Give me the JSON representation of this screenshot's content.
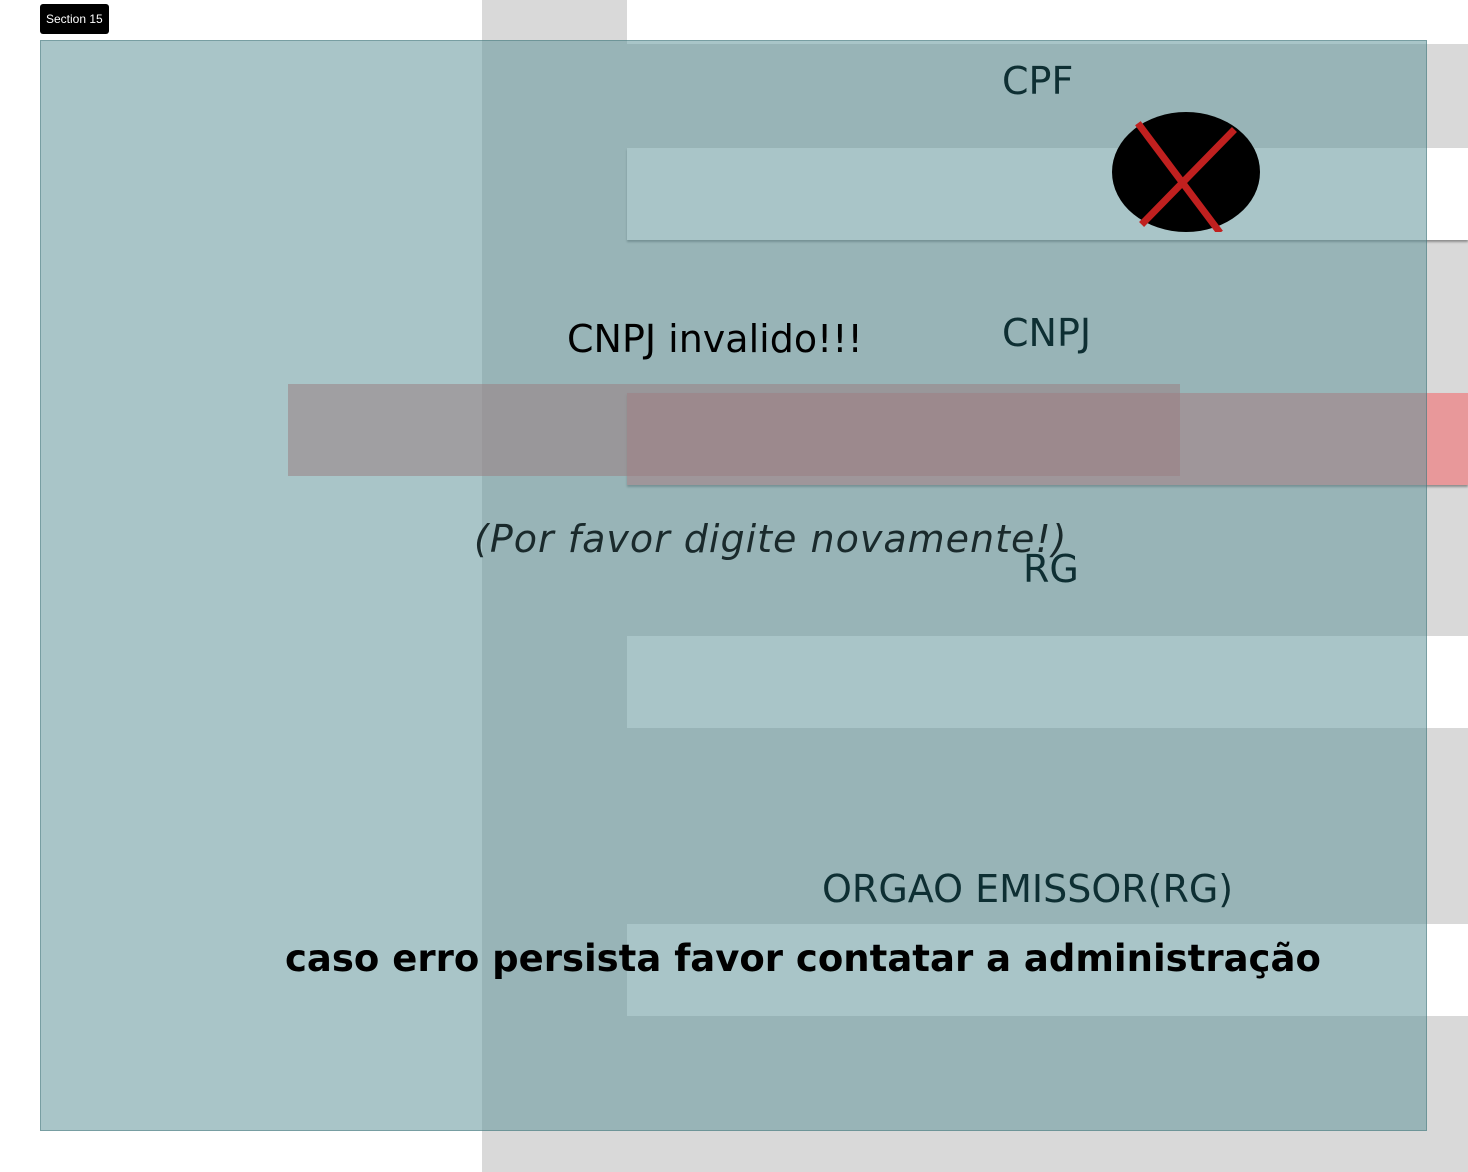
{
  "section_tag": "Section 15",
  "form": {
    "cpf_label": "CPF",
    "cnpj_label": "CNPJ",
    "rg_label": "RG",
    "orgao_label": "ORGAO EMISSOR(RG)"
  },
  "error": {
    "title": "CNPJ invalido!!!",
    "hint": "(Por favor digite novamente!)",
    "contact": "caso erro persista favor contatar a administração",
    "close_icon": "close-icon"
  },
  "colors": {
    "overlay": "#63969b",
    "error_strip": "#dc6464",
    "icon_bg": "#000000",
    "icon_x": "#c0201f"
  }
}
